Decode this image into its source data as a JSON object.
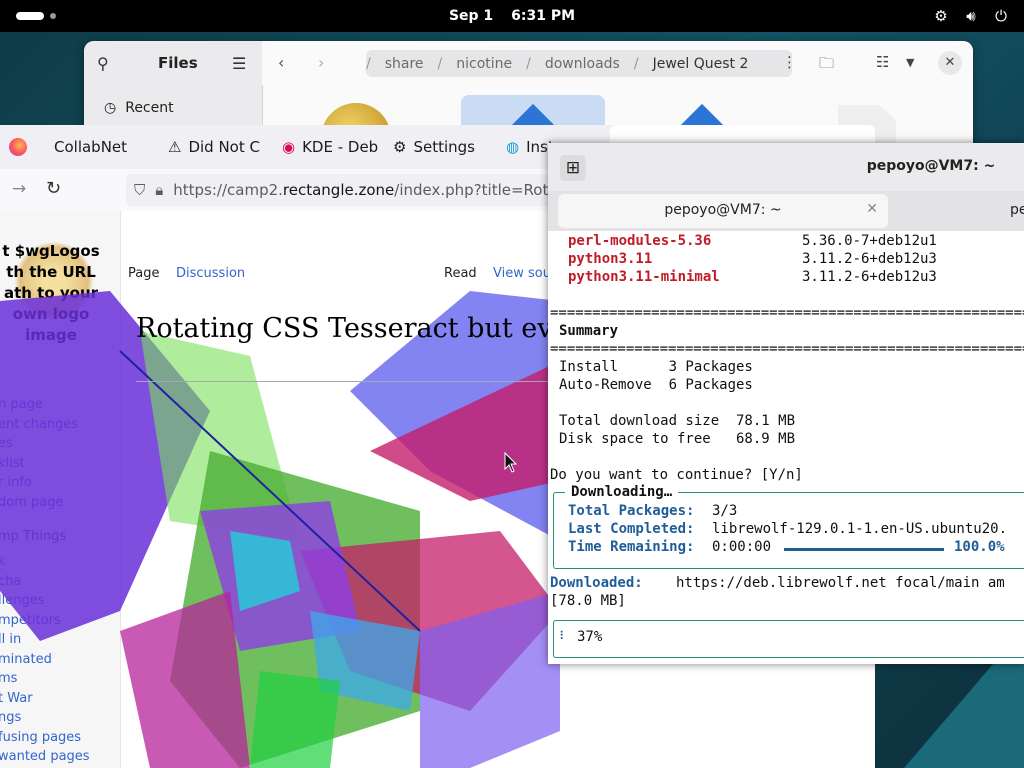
{
  "topbar": {
    "date": "Sep 1",
    "time": "6:31 PM"
  },
  "files": {
    "title": "Files",
    "sidebar_recent": "Recent",
    "breadcrumbs": [
      "share",
      "nicotine",
      "downloads",
      "Jewel Quest 2"
    ]
  },
  "browser": {
    "tabs": [
      {
        "label": "CollabNet",
        "icon": "globe-icon"
      },
      {
        "label": "Did Not C",
        "icon": "warning-icon"
      },
      {
        "label": "KDE - Deb",
        "icon": "debian-icon"
      },
      {
        "label": "Settings",
        "icon": "gear-icon"
      },
      {
        "label": "Insta",
        "icon": "globe-icon"
      }
    ],
    "url_prefix": "https://camp2.",
    "url_domain": "rectangle.zone",
    "url_suffix": "/index.php?title=Rotatin"
  },
  "wiki": {
    "logo_text": "t $wgLogos th the URL ath to your own logo image",
    "tabs": {
      "page": "Page",
      "discussion": "Discussion",
      "read": "Read",
      "view_source": "View sou"
    },
    "title": "Rotating CSS Tesseract but every p Cube",
    "nav_links": [
      "n page",
      "ent changes",
      "es",
      "klist",
      "r info",
      "dom page"
    ],
    "section_heading": "mp Things",
    "section_links": [
      "k",
      "cha",
      "llenges",
      "mpetitors",
      "ll in",
      "minated",
      "ms",
      "t War",
      "ngs",
      "fusing pages",
      "wanted pages"
    ]
  },
  "terminal": {
    "window_title": "pepoyo@VM7: ~",
    "tab1": "pepoyo@VM7: ~",
    "tab2": "pe",
    "packages": [
      {
        "name": "perl-modules-5.36",
        "version": "5.36.0-7+deb12u1"
      },
      {
        "name": "python3.11",
        "version": "3.11.2-6+deb12u3"
      },
      {
        "name": "python3.11-minimal",
        "version": "3.11.2-6+deb12u3"
      }
    ],
    "separator": "==================================================================",
    "summary_heading": "Summary",
    "install_line": "Install      3 Packages",
    "autoremove_line": "Auto-Remove  6 Packages",
    "download_size_line": "Total download size  78.1 MB",
    "disk_space_line": "Disk space to free   68.9 MB",
    "prompt": "Do you want to continue? [Y/n]",
    "downloading_title": "Downloading…",
    "total_packages_label": "Total Packages:",
    "total_packages_value": "3/3",
    "last_completed_label": "Last Completed:",
    "last_completed_value": "librewolf-129.0.1-1.en-US.ubuntu20.",
    "time_remaining_label": "Time Remaining:",
    "time_remaining_value": "0:00:00",
    "download_percent": "100.0%",
    "download_progress": 1.0,
    "downloaded_label": "Downloaded:",
    "downloaded_url": "https://deb.librewolf.net focal/main am",
    "downloaded_size": "[78.0 MB]",
    "status_percent": "37%"
  },
  "colors": {
    "accent_blue": "#1f5d99",
    "package_red": "#c01c28",
    "box_teal": "#2a8a7a"
  }
}
